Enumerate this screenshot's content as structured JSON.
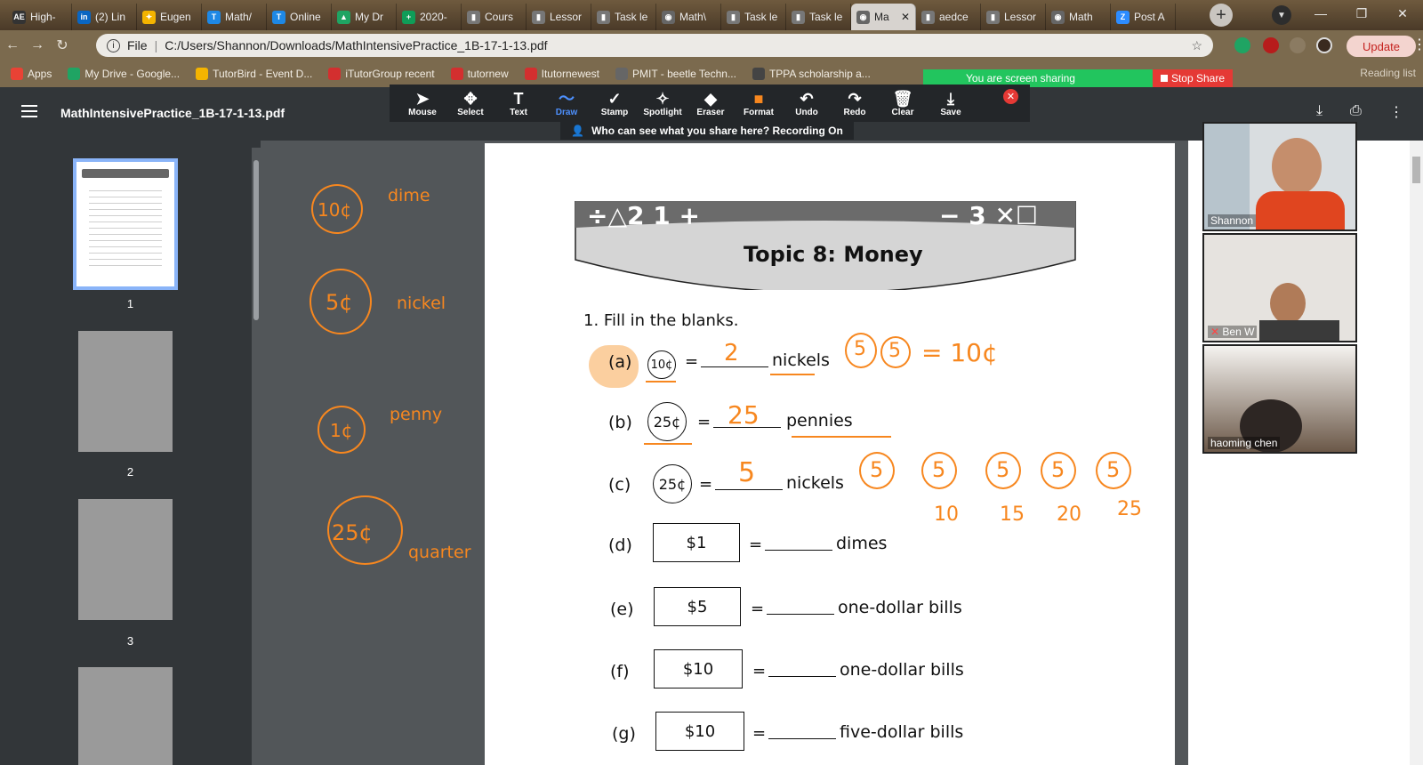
{
  "tabs": [
    {
      "label": "High-",
      "icon": "AE",
      "color": "#333"
    },
    {
      "label": "(2) Lin",
      "icon": "in",
      "color": "#0a66c2"
    },
    {
      "label": "Eugen",
      "icon": "✦",
      "color": "#f4b400"
    },
    {
      "label": "Math/",
      "icon": "T",
      "color": "#1e88e5"
    },
    {
      "label": "Online",
      "icon": "T",
      "color": "#1e88e5"
    },
    {
      "label": "My Dr",
      "icon": "▲",
      "color": "#1fa463"
    },
    {
      "label": "2020-",
      "icon": "+",
      "color": "#0f9d58"
    },
    {
      "label": "Cours",
      "icon": "▮",
      "color": "#777"
    },
    {
      "label": "Lessor",
      "icon": "▮",
      "color": "#777"
    },
    {
      "label": "Task le",
      "icon": "▮",
      "color": "#777"
    },
    {
      "label": "Math\\",
      "icon": "◉",
      "color": "#666"
    },
    {
      "label": "Task le",
      "icon": "▮",
      "color": "#777"
    },
    {
      "label": "Task le",
      "icon": "▮",
      "color": "#777"
    },
    {
      "label": "Ma",
      "icon": "◉",
      "color": "#666",
      "active": true
    },
    {
      "label": "aedce",
      "icon": "▮",
      "color": "#777"
    },
    {
      "label": "Lessor",
      "icon": "▮",
      "color": "#777"
    },
    {
      "label": "Math",
      "icon": "◉",
      "color": "#666"
    },
    {
      "label": "Post A",
      "icon": "Z",
      "color": "#2d8cff"
    }
  ],
  "address": {
    "scheme": "File",
    "url": "C:/Users/Shannon/Downloads/MathIntensivePractice_1B-17-1-13.pdf"
  },
  "update_label": "Update",
  "bookmarks": [
    {
      "label": "Apps",
      "color": "#e94235"
    },
    {
      "label": "My Drive - Google...",
      "color": "#1fa463"
    },
    {
      "label": "TutorBird - Event D...",
      "color": "#f4b400"
    },
    {
      "label": "iTutorGroup recent",
      "color": "#d32f2f"
    },
    {
      "label": "tutornew",
      "color": "#d32f2f"
    },
    {
      "label": "Itutornewest",
      "color": "#d32f2f"
    },
    {
      "label": "PMIT - beetle Techn...",
      "color": "#666"
    },
    {
      "label": "TPPA scholarship a...",
      "color": "#444"
    }
  ],
  "reading_list": "Reading list",
  "share": {
    "banner": "You are screen sharing",
    "stop": "Stop Share"
  },
  "annotate_tools": [
    {
      "label": "Mouse",
      "icon": "➤"
    },
    {
      "label": "Select",
      "icon": "✥"
    },
    {
      "label": "Text",
      "icon": "T"
    },
    {
      "label": "Draw",
      "icon": "〜",
      "selected": true
    },
    {
      "label": "Stamp",
      "icon": "✓"
    },
    {
      "label": "Spotlight",
      "icon": "✧"
    },
    {
      "label": "Eraser",
      "icon": "◆"
    },
    {
      "label": "Format",
      "icon": "■"
    },
    {
      "label": "Undo",
      "icon": "↶"
    },
    {
      "label": "Redo",
      "icon": "↷"
    },
    {
      "label": "Clear",
      "icon": "🗑"
    },
    {
      "label": "Save",
      "icon": "⤓"
    }
  ],
  "recording_info": "Who can see what you share here? Recording On",
  "pdf_title": "MathIntensivePractice_1B-17-1-13.pdf",
  "thumbnails": [
    "1",
    "2",
    "3"
  ],
  "worksheet": {
    "banner_symbols": "÷△2 1 +",
    "banner_symbols_right": "− 3 ✕☐",
    "title": "Topic 8: Money",
    "question": "1.  Fill in the blanks.",
    "rows": [
      {
        "letter": "(a)",
        "value": "10¢",
        "unit": "nickels"
      },
      {
        "letter": "(b)",
        "value": "25¢",
        "unit": "pennies"
      },
      {
        "letter": "(c)",
        "value": "25¢",
        "unit": "nickels"
      },
      {
        "letter": "(d)",
        "value": "$1",
        "unit": "dimes"
      },
      {
        "letter": "(e)",
        "value": "$5",
        "unit": "one-dollar bills"
      },
      {
        "letter": "(f)",
        "value": "$10",
        "unit": "one-dollar bills"
      },
      {
        "letter": "(g)",
        "value": "$10",
        "unit": "five-dollar bills"
      }
    ],
    "eq": "="
  },
  "annotations": {
    "coins": [
      {
        "value": "10¢",
        "name": "dime"
      },
      {
        "value": "5¢",
        "name": "nickel"
      },
      {
        "value": "1¢",
        "name": "penny"
      },
      {
        "value": "25¢",
        "name": "quarter"
      }
    ],
    "answer_a": "2",
    "answer_b": "25",
    "answer_c": "5",
    "work_a_circles": [
      "5",
      "5"
    ],
    "work_a_eq": "= 10¢",
    "work_c_circles": [
      "5",
      "5",
      "5",
      "5",
      "5"
    ],
    "work_c_counts": [
      "10",
      "15",
      "20",
      "25"
    ]
  },
  "participants": [
    {
      "name": "Shannon"
    },
    {
      "name": "Ben W"
    },
    {
      "name": "haoming   chen"
    }
  ]
}
